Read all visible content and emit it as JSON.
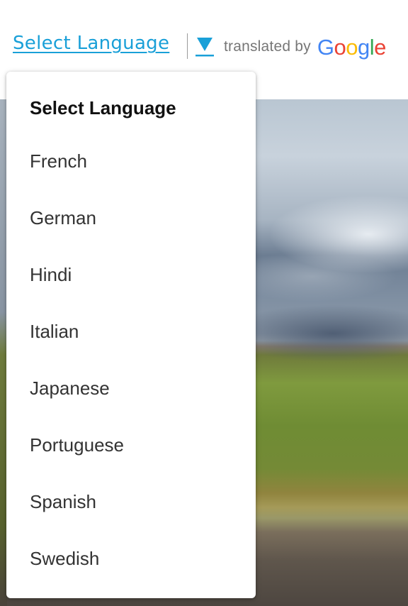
{
  "translate_bar": {
    "select_link_label": "Select Language",
    "arrow_icon": "triangle-down-icon",
    "translated_by_label": "translated by",
    "google_logo": {
      "letters": [
        "G",
        "o",
        "o",
        "g",
        "l",
        "e"
      ],
      "colors": [
        "#4285F4",
        "#EA4335",
        "#FBBC05",
        "#4285F4",
        "#34A853",
        "#EA4335"
      ]
    },
    "accent_color": "#1aa0d8"
  },
  "dropdown": {
    "header": "Select Language",
    "languages": [
      {
        "label": "French"
      },
      {
        "label": "German"
      },
      {
        "label": "Hindi"
      },
      {
        "label": "Italian"
      },
      {
        "label": "Japanese"
      },
      {
        "label": "Portuguese"
      },
      {
        "label": "Spanish"
      },
      {
        "label": "Swedish"
      }
    ]
  },
  "background": {
    "image": "landscape-photo"
  }
}
